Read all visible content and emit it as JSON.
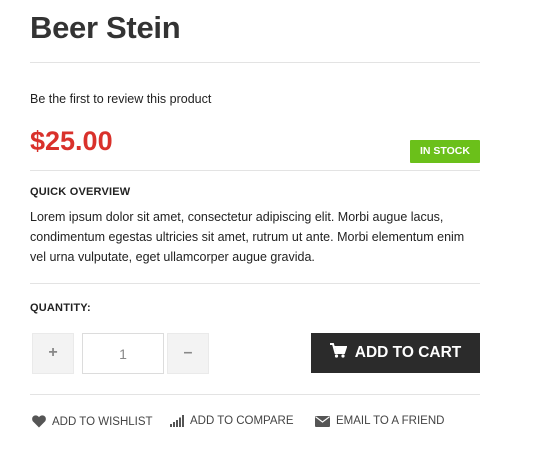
{
  "product": {
    "title": "Beer Stein",
    "review_link": "Be the first to review this product",
    "price": "$25.00",
    "stock_badge": "IN STOCK"
  },
  "overview": {
    "label": "QUICK OVERVIEW",
    "text": "Lorem ipsum dolor sit amet, consectetur adipiscing elit. Morbi augue lacus, condimentum egestas ultricies sit amet, rutrum ut ante. Morbi elementum enim vel urna vulputate, eget ullamcorper augue gravida."
  },
  "quantity": {
    "label": "QUANTITY:",
    "increment": "+",
    "decrement": "–",
    "value": "1"
  },
  "cart": {
    "label": "ADD TO CART",
    "icon": "cart-icon"
  },
  "actions": [
    {
      "label": "ADD TO WISHLIST",
      "icon": "heart-icon"
    },
    {
      "label": "ADD TO COMPARE",
      "icon": "bar-chart-icon"
    },
    {
      "label": "EMAIL TO A FRIEND",
      "icon": "envelope-icon"
    }
  ],
  "colors": {
    "price": "#d9312b",
    "stock": "#6bc01a",
    "cart_button": "#2b2b2b"
  }
}
